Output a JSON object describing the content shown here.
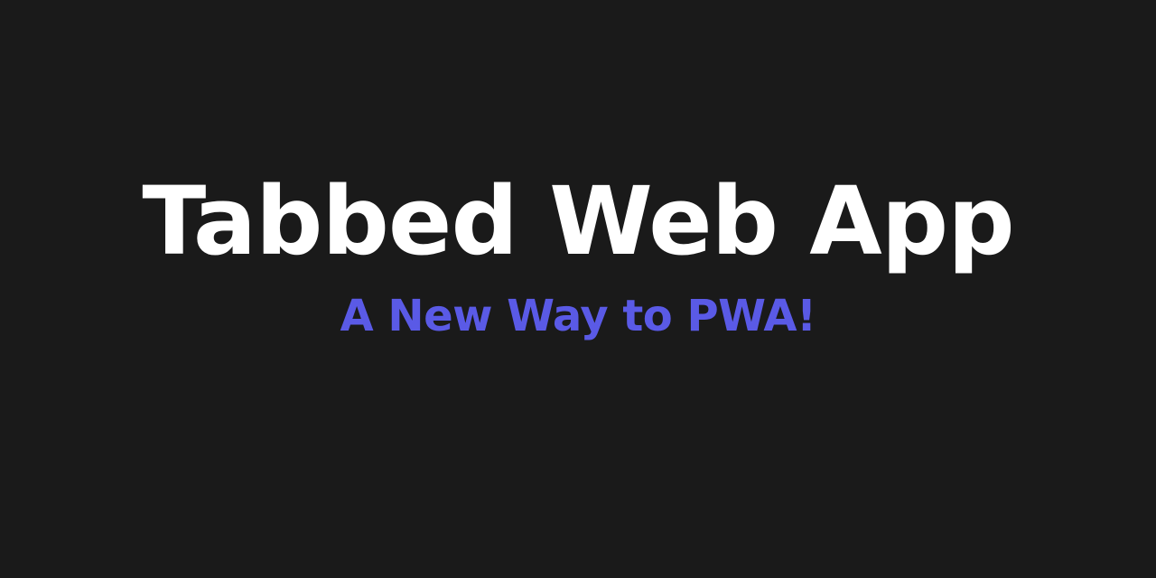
{
  "banner": {
    "title": "Tabbed Web App",
    "subtitle": "A New Way to PWA!"
  },
  "colors": {
    "background": "#1a1a1a",
    "title": "#ffffff",
    "subtitle": "#5a5ae6"
  }
}
